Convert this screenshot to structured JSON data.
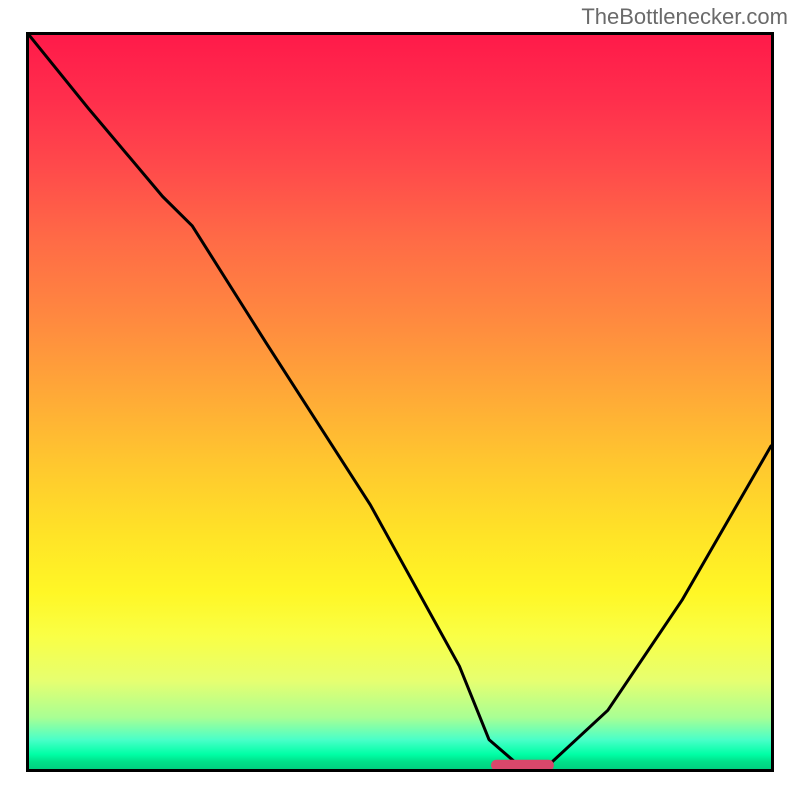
{
  "watermark": "TheBottlenecker.com",
  "chart_data": {
    "type": "line",
    "title": "",
    "xlabel": "",
    "ylabel": "",
    "xlim": [
      0,
      100
    ],
    "ylim": [
      0,
      100
    ],
    "grid": false,
    "series": [
      {
        "name": "bottleneck-curve",
        "x": [
          0,
          8,
          18,
          22,
          32,
          46,
          58,
          62,
          66,
          70,
          78,
          88,
          100
        ],
        "values": [
          100,
          90,
          78,
          74,
          58,
          36,
          14,
          4,
          0.5,
          0.5,
          8,
          23,
          44
        ]
      }
    ],
    "annotations": [
      {
        "name": "optimal-range-marker",
        "x_start": 63,
        "x_end": 70,
        "y": 0.5
      }
    ],
    "background_gradient": {
      "direction": "vertical",
      "stops": [
        {
          "pos": 0,
          "color": "#ff1a4a"
        },
        {
          "pos": 50,
          "color": "#ffb030"
        },
        {
          "pos": 80,
          "color": "#f8ff3a"
        },
        {
          "pos": 100,
          "color": "#00d080"
        }
      ]
    }
  }
}
